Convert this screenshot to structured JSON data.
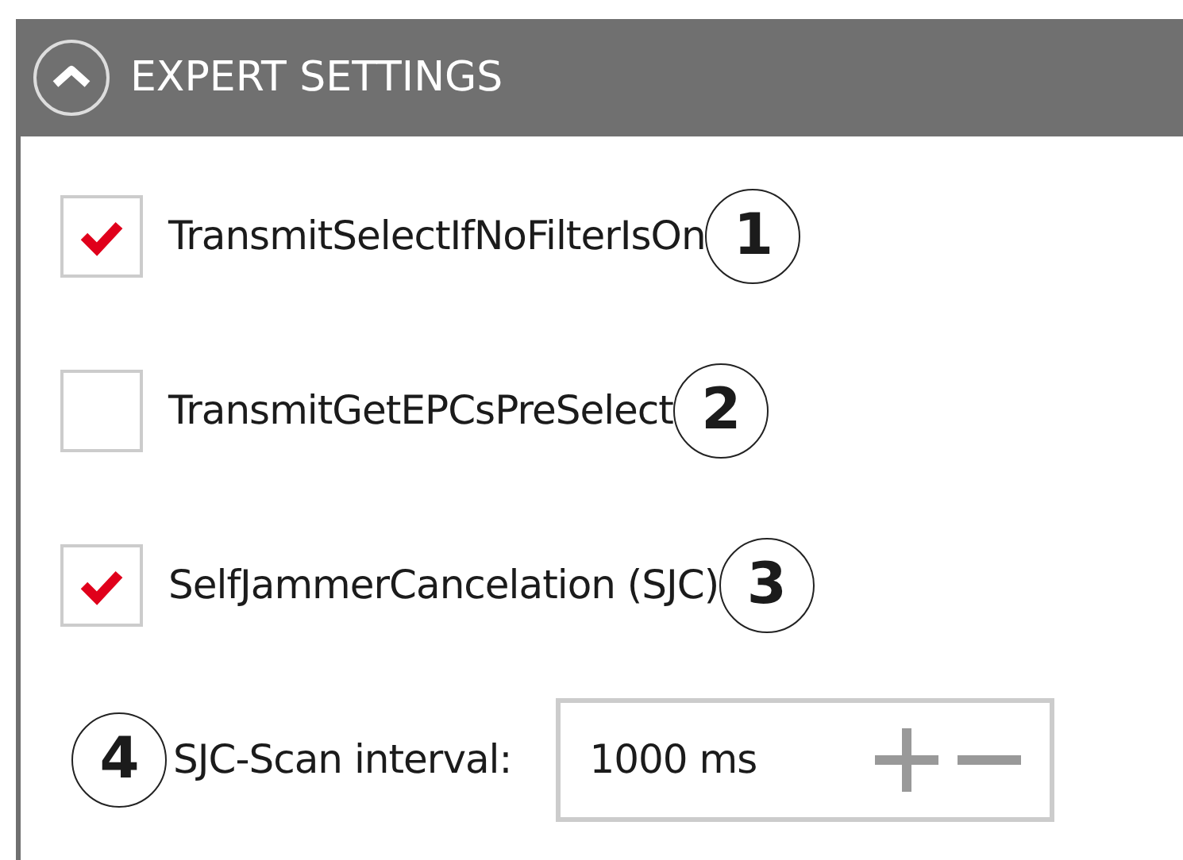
{
  "section": {
    "title": "EXPERT SETTINGS",
    "expanded": true
  },
  "options": [
    {
      "label": "TransmitSelectIfNoFilterIsOn",
      "checked": true,
      "callout": "1"
    },
    {
      "label": "TransmitGetEPCsPreSelect",
      "checked": false,
      "callout": "2"
    },
    {
      "label": "SelfJammerCancelation (SJC)",
      "checked": true,
      "callout": "3"
    }
  ],
  "interval": {
    "callout": "4",
    "label": "SJC-Scan interval:",
    "value": "1000 ms"
  }
}
